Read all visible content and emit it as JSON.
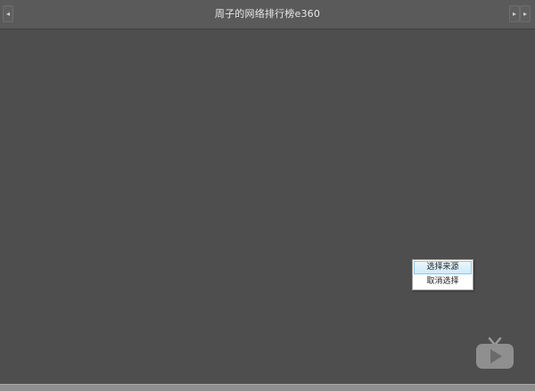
{
  "window": {
    "title": "周子的网络排行榜e360"
  },
  "titlebar": {
    "nav_left_glyph": "◂",
    "nav_right_a_glyph": "▸",
    "nav_right_b_glyph": "▸"
  },
  "context_menu": {
    "items": [
      {
        "label": "选择来源",
        "highlighted": true
      },
      {
        "label": "取消选择",
        "highlighted": false
      }
    ]
  },
  "icons": {
    "nav_left": "chevron-left-icon",
    "nav_right": "chevron-right-icon",
    "tv": "tv-play-icon"
  },
  "colors": {
    "background": "#4e4e4e",
    "titlebar": "#5a5a5a",
    "menu_highlight": "#cfeafa",
    "menu_highlight_border": "#8cc6ea"
  }
}
